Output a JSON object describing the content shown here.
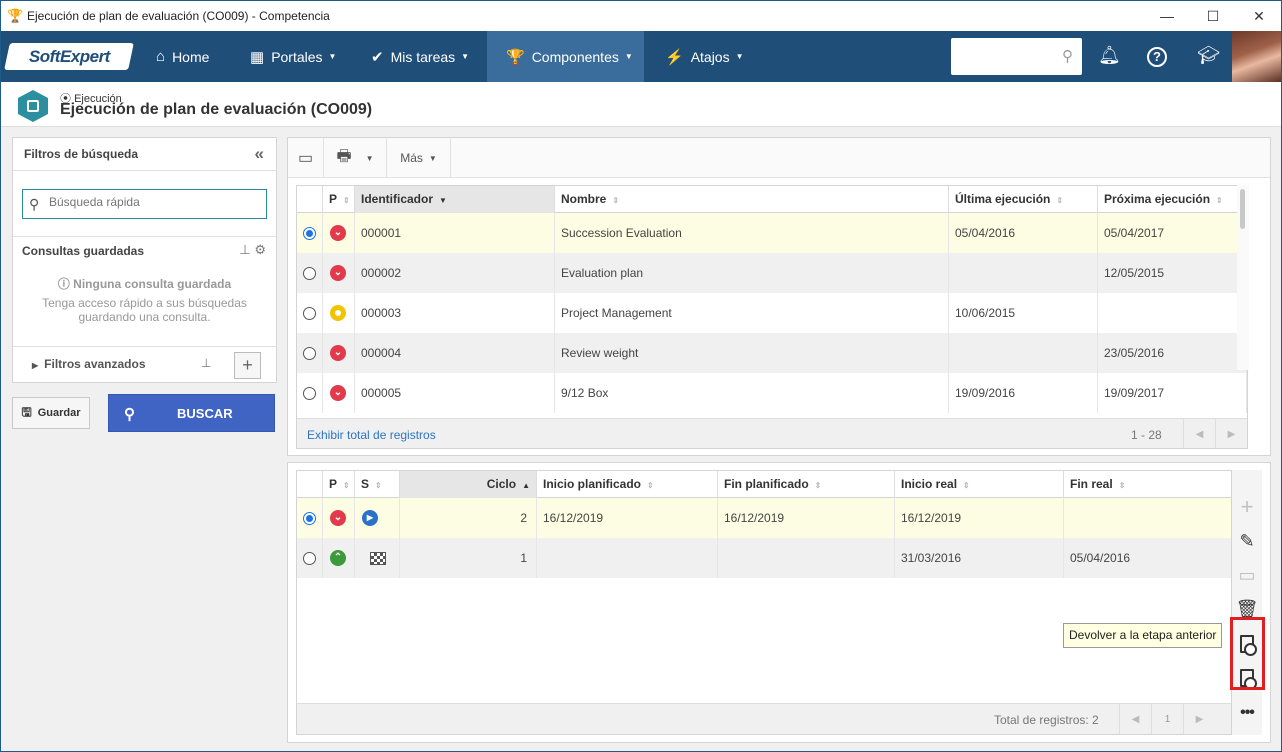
{
  "window": {
    "title": "Ejecución de plan de evaluación (CO009) - Competencia",
    "controls": {
      "minimize": "—",
      "maximize": "☐",
      "close": "✕"
    }
  },
  "navbar": {
    "logo": "SoftExpert",
    "items": [
      {
        "label": "Home",
        "icon": "home-icon"
      },
      {
        "label": "Portales",
        "icon": "grid-icon"
      },
      {
        "label": "Mis tareas",
        "icon": "check-icon"
      },
      {
        "label": "Componentes",
        "icon": "trophy-icon"
      },
      {
        "label": "Atajos",
        "icon": "bolt-icon"
      }
    ],
    "search_placeholder": ""
  },
  "page_header": {
    "subtitle": "Ejecución",
    "title": "Ejecución de plan de evaluación (CO009)"
  },
  "filters": {
    "title": "Filtros de búsqueda",
    "quick_search_placeholder": "Búsqueda rápida",
    "saved_queries_title": "Consultas guardadas",
    "no_saved": "Ninguna consulta guardada",
    "no_saved_desc": "Tenga acceso rápido a sus búsquedas guardando una consulta.",
    "advanced": "Filtros avanzados",
    "save_button": "Guardar",
    "search_button": "BUSCAR"
  },
  "toolbar": {
    "more_label": "Más"
  },
  "plans_table": {
    "columns": [
      "P",
      "Identificador",
      "Nombre",
      "Última ejecución",
      "Próxima ejecución"
    ],
    "rows": [
      {
        "status": "red",
        "id": "000001",
        "name": "Succession Evaluation",
        "last": "05/04/2016",
        "next": "05/04/2017",
        "selected": true
      },
      {
        "status": "red",
        "id": "000002",
        "name": "Evaluation plan",
        "last": "",
        "next": "12/05/2015",
        "selected": false
      },
      {
        "status": "yellow",
        "id": "000003",
        "name": "Project Management",
        "last": "10/06/2015",
        "next": "",
        "selected": false
      },
      {
        "status": "red",
        "id": "000004",
        "name": "Review weight",
        "last": "",
        "next": "23/05/2016",
        "selected": false
      },
      {
        "status": "red",
        "id": "000005",
        "name": "9/12 Box",
        "last": "19/09/2016",
        "next": "19/09/2017",
        "selected": false
      }
    ],
    "footer_link": "Exhibir total de registros",
    "pagination": "1 - 28"
  },
  "cycles_table": {
    "columns": [
      "P",
      "S",
      "Ciclo",
      "Inicio planificado",
      "Fin planificado",
      "Inicio real",
      "Fin real"
    ],
    "rows": [
      {
        "p": "red",
        "s": "play",
        "cycle": "2",
        "plan_start": "16/12/2019",
        "plan_end": "16/12/2019",
        "real_start": "16/12/2019",
        "real_end": "",
        "selected": true
      },
      {
        "p": "green",
        "s": "flag",
        "cycle": "1",
        "plan_start": "",
        "plan_end": "",
        "real_start": "31/03/2016",
        "real_end": "05/04/2016",
        "selected": false
      }
    ],
    "total": "Total de registros: 2",
    "page": "1"
  },
  "tooltip": "Devolver a la etapa anterior",
  "colors": {
    "nav": "#1f4e79",
    "selected_row": "#fdfde3",
    "accent": "#3f64c4",
    "highlight": "#e02020"
  }
}
